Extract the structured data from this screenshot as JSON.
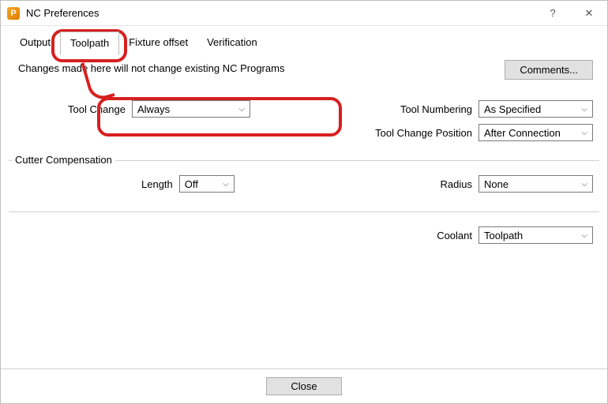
{
  "window": {
    "title": "NC Preferences"
  },
  "tabs": [
    "Output",
    "Toolpath",
    "Fixture offset",
    "Verification"
  ],
  "active_tab": 1,
  "note": "Changes made here will not change existing NC Programs",
  "buttons": {
    "comments": "Comments...",
    "close": "Close"
  },
  "section1": {
    "tool_change": {
      "label": "Tool Change",
      "value": "Always"
    },
    "tool_numbering": {
      "label": "Tool Numbering",
      "value": "As Specified"
    },
    "tool_change_position": {
      "label": "Tool Change Position",
      "value": "After Connection"
    }
  },
  "section2": {
    "title": "Cutter Compensation",
    "length": {
      "label": "Length",
      "value": "Off"
    },
    "radius": {
      "label": "Radius",
      "value": "None"
    }
  },
  "section3": {
    "coolant": {
      "label": "Coolant",
      "value": "Toolpath"
    }
  },
  "icons": {
    "help": "?",
    "close": "✕",
    "chevron": "⌵",
    "app": "P"
  }
}
